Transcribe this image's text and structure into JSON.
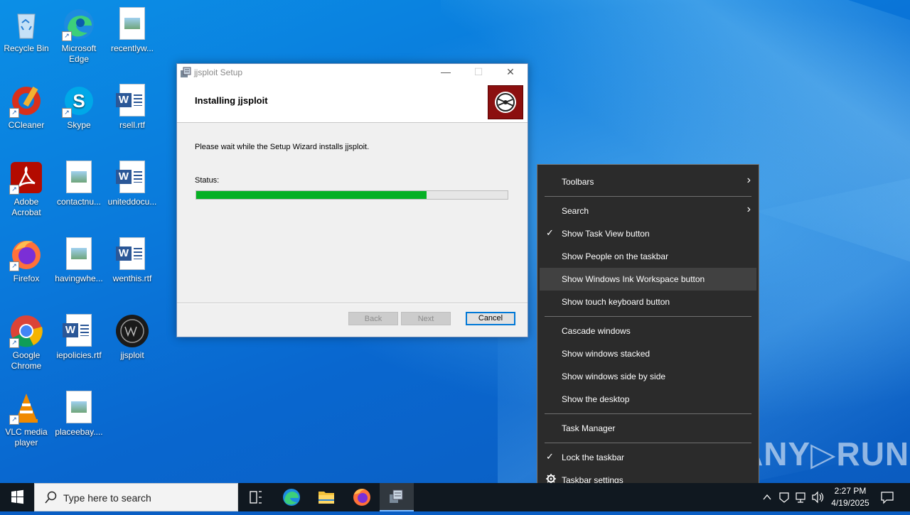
{
  "desktop": {
    "icons": [
      {
        "label": "Recycle Bin"
      },
      {
        "label": "Microsoft Edge"
      },
      {
        "label": "recentlyw..."
      },
      {
        "label": "CCleaner"
      },
      {
        "label": "Skype"
      },
      {
        "label": "rsell.rtf"
      },
      {
        "label": "Adobe Acrobat"
      },
      {
        "label": "contactnu..."
      },
      {
        "label": "uniteddocu..."
      },
      {
        "label": "Firefox"
      },
      {
        "label": "havingwhe..."
      },
      {
        "label": "wenthis.rtf"
      },
      {
        "label": "Google Chrome"
      },
      {
        "label": "iepolicies.rtf"
      },
      {
        "label": "jjsploit"
      },
      {
        "label": "VLC media player"
      },
      {
        "label": "placeebay...."
      }
    ]
  },
  "installer": {
    "window_title": "jjsploit Setup",
    "heading": "Installing jjsploit",
    "message": "Please wait while the Setup Wizard installs jjsploit.",
    "status_label": "Status:",
    "progress": 0.74,
    "progress_color": "#06b025",
    "buttons": {
      "back": "Back",
      "next": "Next",
      "cancel": "Cancel"
    }
  },
  "context_menu": {
    "items": [
      {
        "label": "Toolbars",
        "submenu": true
      },
      {
        "label": "Search",
        "submenu": true
      },
      {
        "label": "Show Task View button",
        "checked": true
      },
      {
        "label": "Show People on the taskbar"
      },
      {
        "label": "Show Windows Ink Workspace button",
        "highlighted": true
      },
      {
        "label": "Show touch keyboard button"
      },
      {
        "label": "Cascade windows"
      },
      {
        "label": "Show windows stacked"
      },
      {
        "label": "Show windows side by side"
      },
      {
        "label": "Show the desktop"
      },
      {
        "label": "Task Manager"
      },
      {
        "label": "Lock the taskbar",
        "checked": true
      },
      {
        "label": "Taskbar settings",
        "icon": "gear-icon"
      }
    ],
    "check_glyph": "✓",
    "arrow_glyph": "›"
  },
  "watermark": "ANY▷RUN",
  "taskbar": {
    "search_placeholder": "Type here to search",
    "time": "2:27 PM",
    "date": "4/19/2025"
  }
}
